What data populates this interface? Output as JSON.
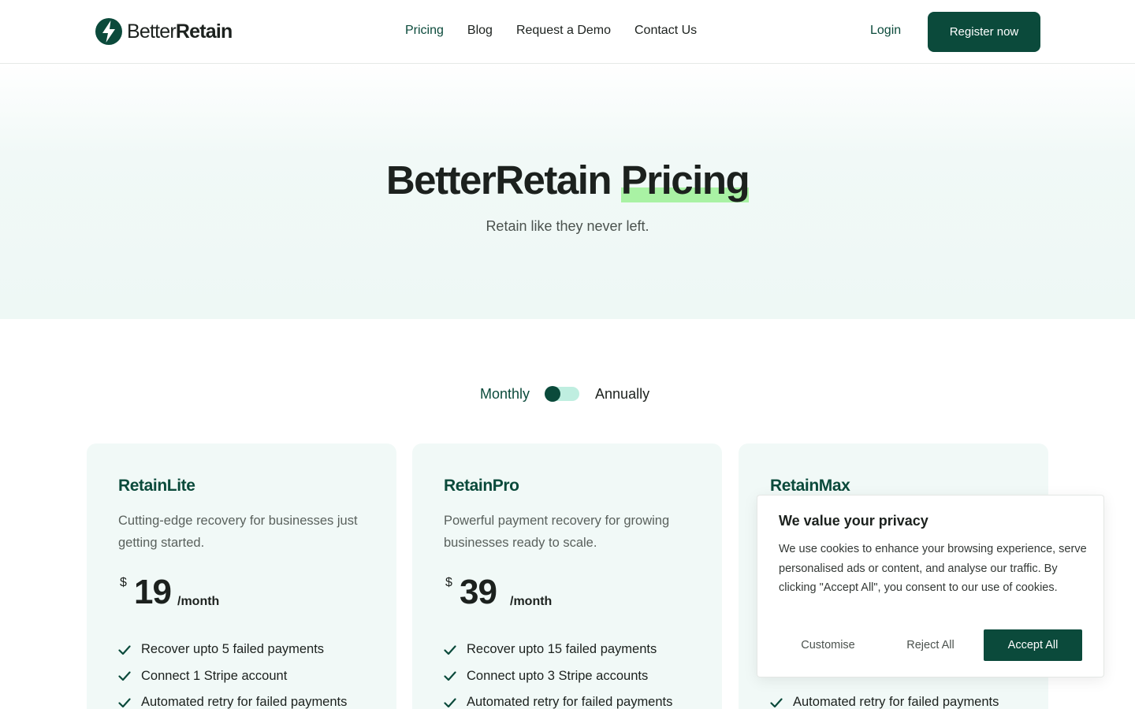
{
  "brand": {
    "name_regular": "Better",
    "name_bold": "Retain",
    "accent_color": "#0b4a3b",
    "highlight_color": "#a9f2a4",
    "logo_icon": "lightning-bolt-icon"
  },
  "nav": {
    "items": [
      {
        "label": "Pricing",
        "active": true
      },
      {
        "label": "Blog",
        "active": false
      },
      {
        "label": "Request a Demo",
        "active": false
      },
      {
        "label": "Contact Us",
        "active": false
      }
    ],
    "login_label": "Login",
    "register_label": "Register now"
  },
  "hero": {
    "title_part1": "BetterRetain",
    "title_highlight": "Pricing",
    "subtitle": "Retain like they never left."
  },
  "billing_toggle": {
    "left_label": "Monthly",
    "right_label": "Annually",
    "selected": "Monthly"
  },
  "plans": [
    {
      "name": "RetainLite",
      "description": "Cutting-edge recovery for businesses just getting started.",
      "currency": "$",
      "price": "19",
      "period": "/month",
      "features": [
        "Recover upto 5 failed payments",
        "Connect 1 Stripe account",
        "Automated retry for failed payments"
      ]
    },
    {
      "name": "RetainPro",
      "description": "Powerful payment recovery for growing businesses ready to scale.",
      "currency": "$",
      "price": "39",
      "period": "/month",
      "features": [
        "Recover upto 15 failed payments",
        "Connect upto 3 Stripe accounts",
        "Automated retry for failed payments"
      ]
    },
    {
      "name": "RetainMax",
      "features": [
        "Automated retry for failed payments"
      ]
    }
  ],
  "cookie_banner": {
    "title": "We value your privacy",
    "body": "We use cookies to enhance your browsing experience, serve personalised ads or content, and analyse our traffic. By clicking \"Accept All\", you consent to our use of cookies.",
    "customise_label": "Customise",
    "reject_label": "Reject All",
    "accept_label": "Accept All"
  }
}
